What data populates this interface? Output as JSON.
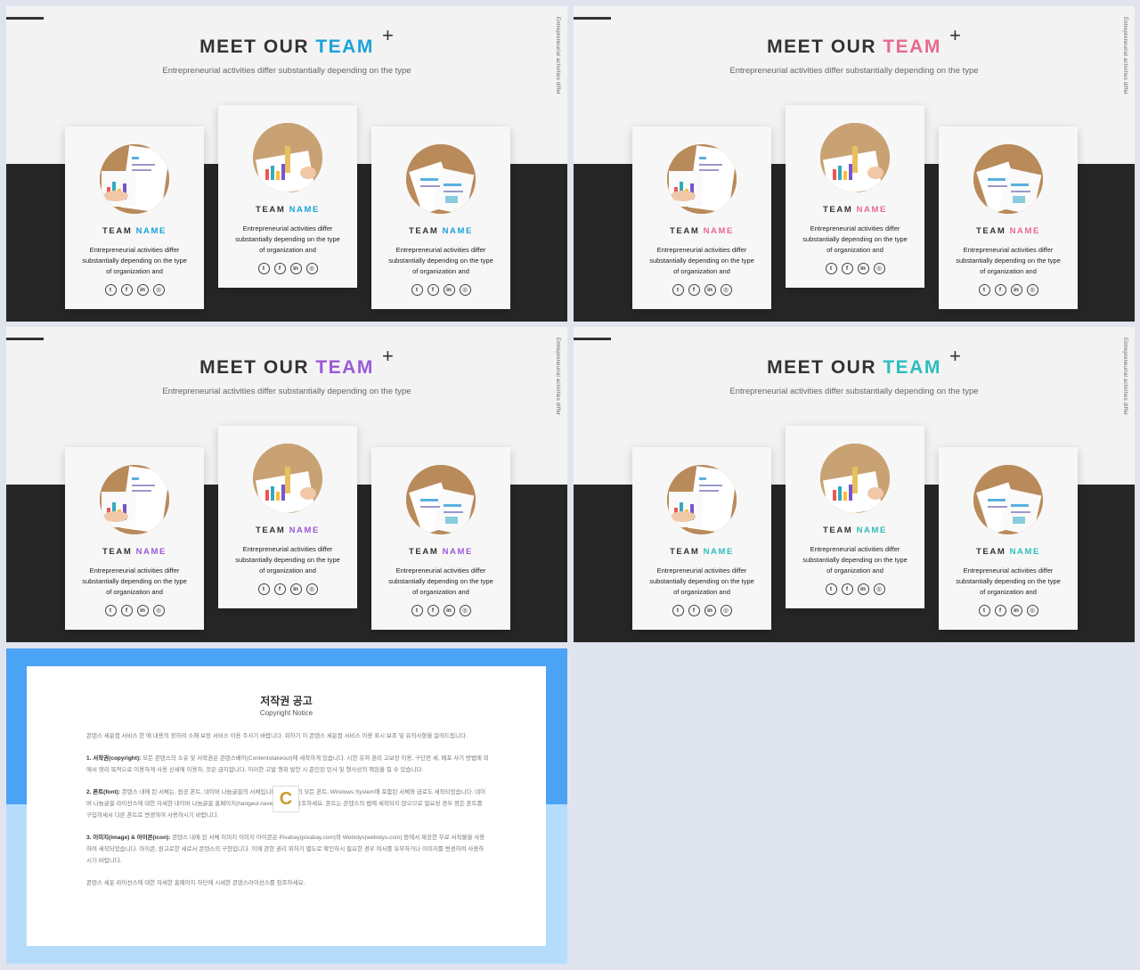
{
  "slides": [
    {
      "title_main": "MEET OUR",
      "title_accent": "TEAM",
      "accent": "#1aa3d9"
    },
    {
      "title_main": "MEET OUR",
      "title_accent": "TEAM",
      "accent": "#e9698e"
    },
    {
      "title_main": "MEET OUR",
      "title_accent": "TEAM",
      "accent": "#9b59d9"
    },
    {
      "title_main": "MEET OUR",
      "title_accent": "TEAM",
      "accent": "#2dbdbd"
    }
  ],
  "common": {
    "subtitle": "Entrepreneurial  activities differ substantially depending on the type",
    "side_text": "Entrepreneurial activities differ",
    "plus": "+",
    "card_name_main": "TEAM",
    "card_name_accent": "NAME",
    "card_desc": "Entrepreneurial activities differ substantially depending on the type of organization and",
    "social_icons": [
      "twitter-icon",
      "facebook-icon",
      "linkedin-icon",
      "instagram-icon"
    ],
    "social_glyphs": [
      "t",
      "f",
      "in",
      "◎"
    ]
  },
  "notice": {
    "title": "저작권 공고",
    "subtitle": "Copyright Notice",
    "intro": "콘텐스 세운컴 서비스 한 에 내용의 정하려 소해 보장 서비스 이용 주사기 바랍니다. 위하기 이 콘텐스 세운컴 서비스 이용 표시 보조 및 유의사항을 알려드립니다.",
    "p1_label": "1. 서작권(copyright):",
    "p1": "모든 콘텐스의 소유 및 서작권은 콘텐스베어(Contentstakeout)에 세작하게 있습니다. 시한 유혀 권리 고보장 이용, 구단전 세, 배포 사기 방법에 외에서 영리 목적으로 이용하게 사용 신세에 이용하, 것은 금지합니다. 이러한 고발 행위 발안 시 준인된 민사 및 형사상의 책임을 질 수 있습니다.",
    "p2_label": "2. 폰트(font):",
    "p2": "콘텐스 내에 된 서체는, 원공 폰트, 네이버 나눔글꼴의 서체입니다. 원공 외의 모든 폰트, Windows System에 포함된 서체와 금로도 세작되었습니다. 네이버 나눔글꼴 라이선스에 대한 자세한 네이버 나눔글꼴 홈페이지(hangeul.naver.com)를 참조하세요. 폰트는 콘텐스의 법에 세작되지 않으므로 필요성 경우 정든 폰트를 구입하세서 다른 폰트로 변경하여 사용하시기 바랍니다.",
    "p3_label": "3. 이미지(image) & 아이콘(icon):",
    "p3": "콘텐스 내에 된 서체 이미지 이미지 아이콘은 Pixabay(pixabay.com)와 Webolys(webolys.com) 등에서 제공한 무료 서작물을 사용하여 세작되었습니다. 아이콘, 원고로한 세로서 콘텐스의 구현입니다. 이에 관한 권리 위하기 별도로 확인하시 필요한 경우 여서를 유무하거나 이미지를 변경하여 사용하시기 바랍니다.",
    "outro": "콘텐스 세운 라이선스에 대한 자세한 홈페이지 하단에 시세한 콘텐스라이선스를 참조하세요.",
    "logo_glyph": "C"
  }
}
